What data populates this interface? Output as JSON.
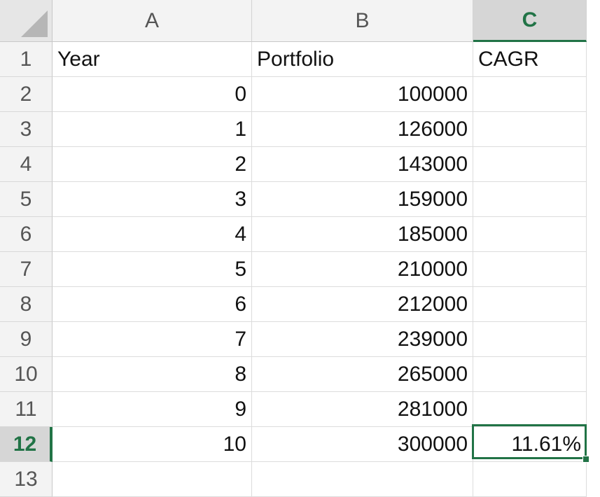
{
  "columns": [
    "A",
    "B",
    "C"
  ],
  "rows": [
    {
      "num": "1",
      "a": "Year",
      "b": "Portfolio",
      "c": ""
    },
    {
      "num": "2",
      "a": "0",
      "b": "100000",
      "c": ""
    },
    {
      "num": "3",
      "a": "1",
      "b": "126000",
      "c": ""
    },
    {
      "num": "4",
      "a": "2",
      "b": "143000",
      "c": ""
    },
    {
      "num": "5",
      "a": "3",
      "b": "159000",
      "c": ""
    },
    {
      "num": "6",
      "a": "4",
      "b": "185000",
      "c": ""
    },
    {
      "num": "7",
      "a": "5",
      "b": "210000",
      "c": ""
    },
    {
      "num": "8",
      "a": "6",
      "b": "212000",
      "c": ""
    },
    {
      "num": "9",
      "a": "7",
      "b": "239000",
      "c": ""
    },
    {
      "num": "10",
      "a": "8",
      "b": "265000",
      "c": ""
    },
    {
      "num": "11",
      "a": "9",
      "b": "281000",
      "c": ""
    },
    {
      "num": "12",
      "a": "10",
      "b": "300000",
      "c": "11.61%"
    },
    {
      "num": "13",
      "a": "",
      "b": "",
      "c": ""
    }
  ],
  "header_c1": "CAGR",
  "selected_cell": "C12",
  "accent_color": "#217346"
}
